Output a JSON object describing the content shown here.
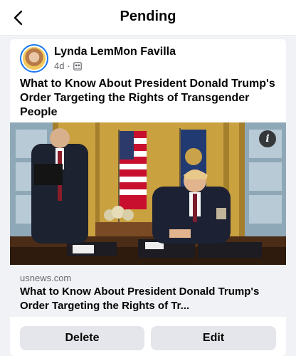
{
  "header": {
    "title": "Pending",
    "back_icon": "chevron-left-icon"
  },
  "post": {
    "author": "Lynda LemMon Favilla",
    "time": "4d",
    "separator": "·",
    "audience_icon": "group-audience-icon",
    "text": "What to Know About President Donald Trump's Order Targeting the Rights of Transgender People",
    "photo_info_label": "i",
    "link": {
      "domain": "usnews.com",
      "title": "What to Know About President Donald Trump's Order Targeting the Rights of Tr..."
    }
  },
  "actions": {
    "delete_label": "Delete",
    "edit_label": "Edit"
  },
  "colors": {
    "accent": "#1877f2",
    "button_bg": "#e4e6eb",
    "secondary_text": "#65676b",
    "feed_bg": "#f0f2f5"
  }
}
